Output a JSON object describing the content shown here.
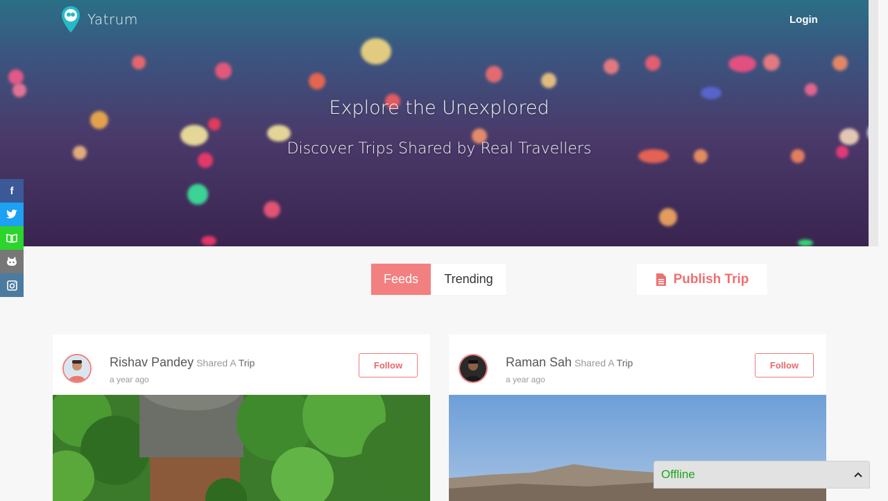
{
  "brand": {
    "name": "Yatrum"
  },
  "nav": {
    "login": "Login"
  },
  "hero": {
    "title": "Explore the Unexplored",
    "subtitle": "Discover Trips Shared by Real Travellers"
  },
  "social": [
    {
      "icon": "facebook-icon",
      "glyph": "f",
      "color": "#3b5998"
    },
    {
      "icon": "twitter-icon",
      "glyph": "🐦",
      "color": "#1da1f2"
    },
    {
      "icon": "book-icon",
      "glyph": "📖",
      "color": "#2cd52c"
    },
    {
      "icon": "github-icon",
      "glyph": "🐱",
      "color": "#777777"
    },
    {
      "icon": "instagram-icon",
      "glyph": "◘",
      "color": "#4c7ba0"
    }
  ],
  "tabs": {
    "feeds": "Feeds",
    "trending": "Trending"
  },
  "publish": {
    "label": "Publish Trip"
  },
  "posts": [
    {
      "name": "Rishav Pandey",
      "shared": "Shared A",
      "trip": "Trip",
      "time": "a year ago",
      "follow": "Follow"
    },
    {
      "name": "Raman Sah",
      "shared": "Shared A",
      "trip": "Trip",
      "time": "a year ago",
      "follow": "Follow"
    }
  ],
  "chat": {
    "status": "Offline",
    "chevron": "⌃"
  },
  "colors": {
    "accent": "#f28080",
    "offline": "#1ba51b"
  }
}
